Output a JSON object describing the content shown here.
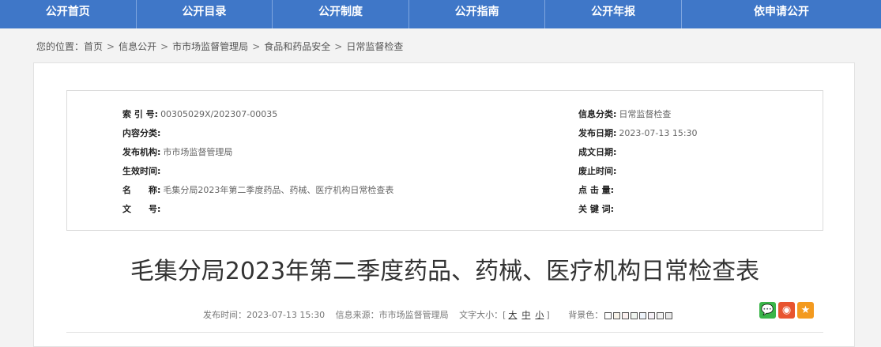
{
  "nav": [
    {
      "label": "公开首页"
    },
    {
      "label": "公开目录"
    },
    {
      "label": "公开制度"
    },
    {
      "label": "公开指南"
    },
    {
      "label": "公开年报"
    },
    {
      "label": "依申请公开"
    }
  ],
  "breadcrumb": {
    "prefix": "您的位置：",
    "items": [
      "首页",
      "信息公开",
      "市市场监督管理局",
      "食品和药品安全",
      "日常监督检查"
    ],
    "separator": ">"
  },
  "meta": {
    "left": [
      {
        "label": "索 引 号:",
        "value": "00305029X/202307-00035"
      },
      {
        "label": "内容分类:",
        "value": ""
      },
      {
        "label": "发布机构:",
        "value": "市市场监督管理局"
      },
      {
        "label": "生效时间:",
        "value": ""
      },
      {
        "label": "名　　称:",
        "value": "毛集分局2023年第二季度药品、药械、医疗机构日常检查表"
      },
      {
        "label": "文　　号:",
        "value": ""
      }
    ],
    "right": [
      {
        "label": "信息分类:",
        "value": "日常监督检查"
      },
      {
        "label": "发布日期:",
        "value": "2023-07-13 15:30"
      },
      {
        "label": "成文日期:",
        "value": ""
      },
      {
        "label": "废止时间:",
        "value": ""
      },
      {
        "label": "点 击 量:",
        "value": ""
      },
      {
        "label": "关 键 词:",
        "value": ""
      }
    ]
  },
  "article": {
    "title": "毛集分局2023年第二季度药品、药械、医疗机构日常检查表",
    "publish_label": "发布时间：",
    "publish_time": "2023-07-13 15:30",
    "source_label": "信息来源：",
    "source": "市市场监督管理局",
    "font_size_label": "文字大小：[",
    "font_sizes": [
      "大",
      "中",
      "小"
    ],
    "font_size_close": "]",
    "bg_label": "背景色："
  },
  "colors": {
    "nav_bg": "#3f77c8",
    "bg_swatches": [
      "#ffffff",
      "#f7f2e8",
      "#fbf0ef",
      "#f0f5f0",
      "#eef4fb",
      "#f6f1f8",
      "#f2f2f2",
      "#e8e8e8"
    ],
    "share": [
      {
        "icon": "wechat-icon",
        "color": "#3bb54a",
        "glyph": "💬"
      },
      {
        "icon": "weibo-icon",
        "color": "#e8542f",
        "glyph": "◉"
      },
      {
        "icon": "favorite-star-icon",
        "color": "#f39a1f",
        "glyph": "★"
      }
    ]
  }
}
